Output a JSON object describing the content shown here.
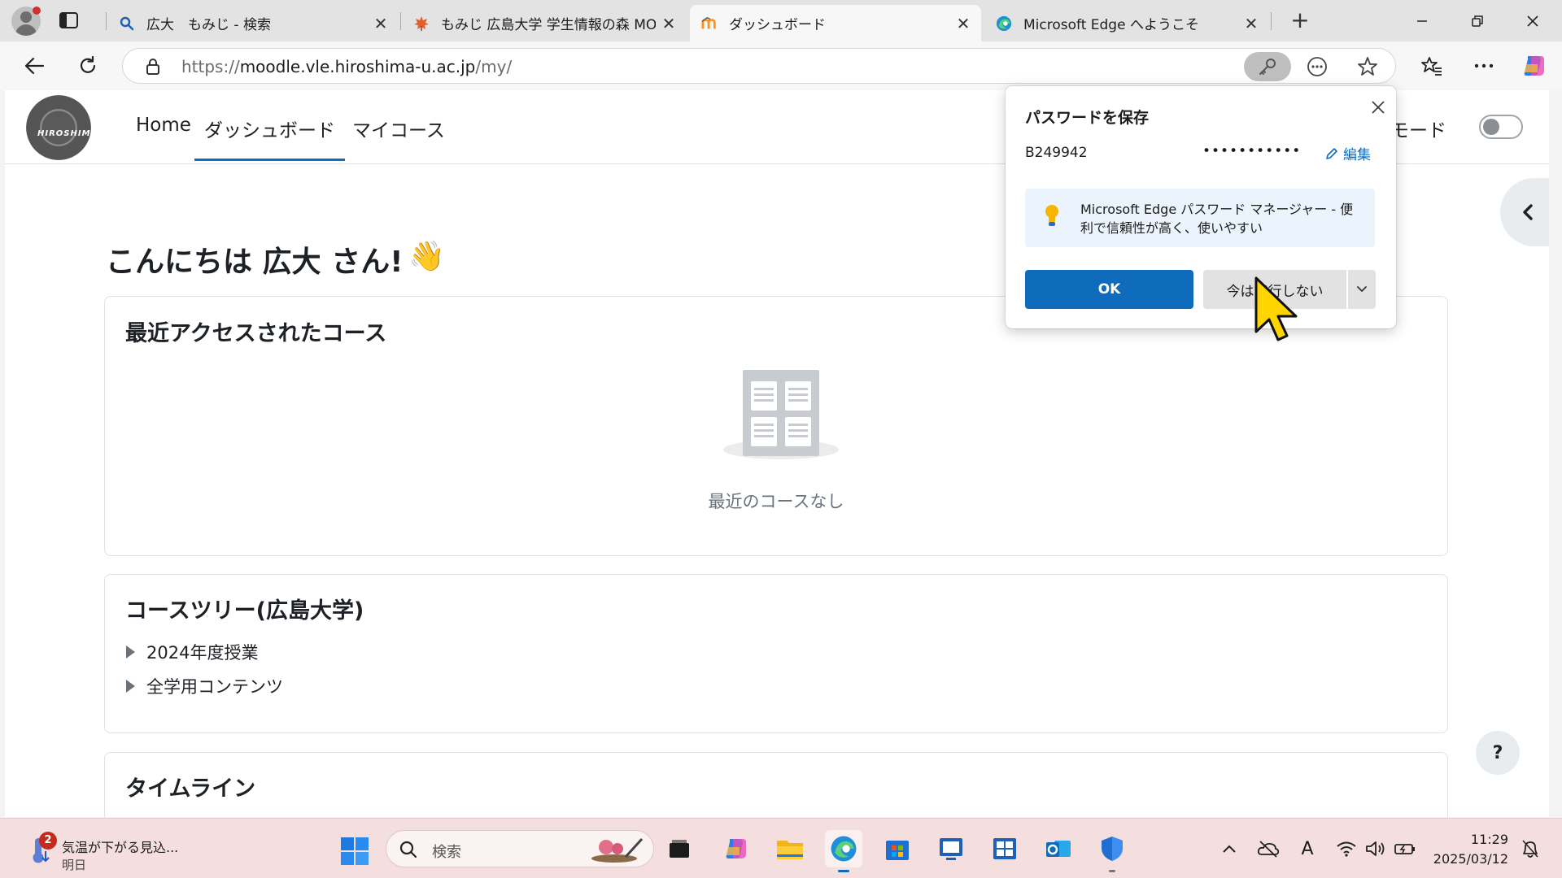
{
  "browser": {
    "tabs": [
      {
        "title": "広大　もみじ - 検索",
        "favicon": "search-icon",
        "active": false
      },
      {
        "title": "もみじ 広島大学 学生情報の森 MO",
        "favicon": "maple-leaf-icon",
        "active": false
      },
      {
        "title": "ダッシュボード",
        "favicon": "moodle-icon",
        "active": true
      },
      {
        "title": "Microsoft Edge へようこそ",
        "favicon": "edge-icon",
        "active": false
      }
    ],
    "address": {
      "scheme": "https://",
      "host": "moodle.vle.hiroshima-u.ac.jp",
      "path": "/my/"
    }
  },
  "moodle": {
    "nav": {
      "links": [
        "Home",
        "ダッシュボード",
        "マイコース"
      ],
      "active": "ダッシュボード",
      "edit_mode_label": "集モード",
      "edit_mode_on": false
    },
    "logo_text": "HIROSHIMA",
    "greeting": "こんにちは 広大 さん!",
    "greeting_emoji": "👋",
    "recent": {
      "title": "最近アクセスされたコース",
      "empty_text": "最近のコースなし"
    },
    "course_tree": {
      "title": "コースツリー(広島大学)",
      "items": [
        "2024年度授業",
        "全学用コンテンツ"
      ]
    },
    "timeline": {
      "title": "タイムライン"
    },
    "help_label": "?"
  },
  "password_popup": {
    "title": "パスワードを保存",
    "username": "B249942",
    "password_mask": "•••••••••••",
    "edit_label": "編集",
    "tip_text": "Microsoft Edge パスワード マネージャー - 便利で信頼性が高く、使いやすい",
    "ok_label": "OK",
    "never_label": "今は実行しない"
  },
  "taskbar": {
    "weather": {
      "badge": "2",
      "headline": "気温が下がる見込...",
      "subline": "明日"
    },
    "search_placeholder": "検索",
    "clock": {
      "time": "11:29",
      "date": "2025/03/12"
    },
    "ime_indicator": "A"
  },
  "colors": {
    "accent": "#0f6cbd",
    "moodle_active_underline": "#0f6cbf",
    "taskbar_bg": "#f4dede"
  }
}
